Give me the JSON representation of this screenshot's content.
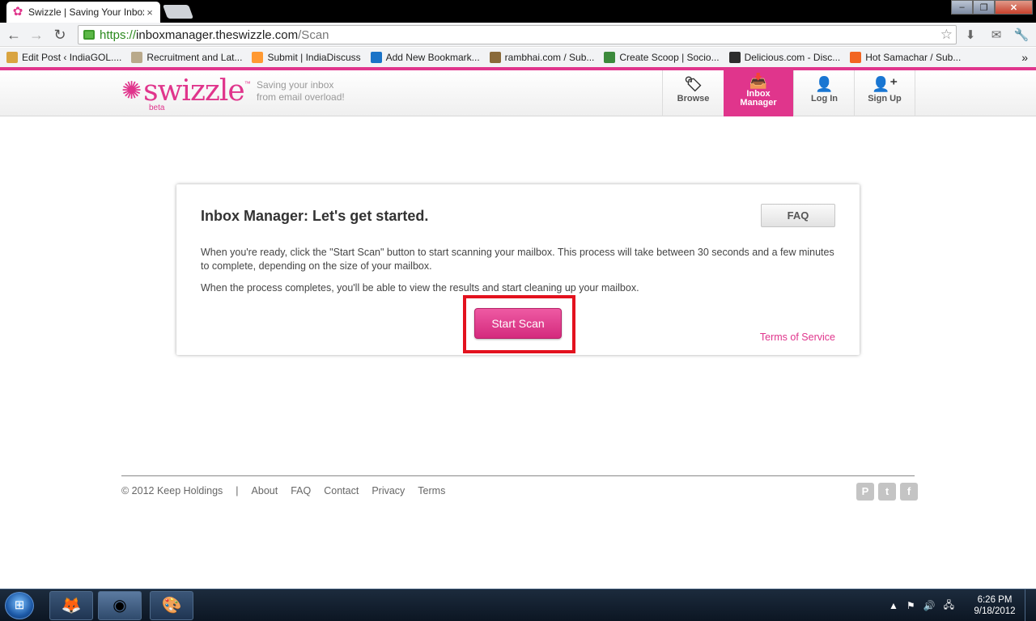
{
  "browser": {
    "tab_title": "Swizzle | Saving Your Inbox",
    "tab_close": "×",
    "url_scheme": "https://",
    "url_host": "inboxmanager.theswizzle.com",
    "url_path": "/Scan",
    "bookmarks": [
      {
        "label": "Edit Post ‹ IndiaGOL....",
        "color": "#d9a441"
      },
      {
        "label": "Recruitment and Lat...",
        "color": "#b9a98b"
      },
      {
        "label": "Submit | IndiaDiscuss",
        "color": "#ff9933"
      },
      {
        "label": "Add New Bookmark...",
        "color": "#1a73c7"
      },
      {
        "label": "rambhai.com / Sub...",
        "color": "#8a6a3a"
      },
      {
        "label": "Create Scoop | Socio...",
        "color": "#3c8a3c"
      },
      {
        "label": "Delicious.com - Disc...",
        "color": "#2d2d2d"
      },
      {
        "label": "Hot Samachar / Sub...",
        "color": "#f26522"
      }
    ],
    "bookmarks_overflow": "»"
  },
  "site": {
    "logo_text": "swizzle",
    "logo_tm": "™",
    "logo_beta": "beta",
    "tagline_line1": "Saving your inbox",
    "tagline_line2": "from email overload!",
    "nav": [
      {
        "label": "Browse",
        "icon": "tag-icon"
      },
      {
        "label_line1": "Inbox",
        "label_line2": "Manager",
        "icon": "inbox-icon",
        "active": true
      },
      {
        "label": "Log In",
        "icon": "user-icon"
      },
      {
        "label": "Sign Up",
        "icon": "add-user-icon"
      }
    ],
    "accent_color": "#e0358c"
  },
  "card": {
    "title": "Inbox Manager: Let's get started.",
    "faq_label": "FAQ",
    "paragraph1": "When you're ready, click the \"Start Scan\" button to start scanning your mailbox. This process will take between 30 seconds and a few minutes to complete, depending on the size of your mailbox.",
    "paragraph2": "When the process completes, you'll be able to view the results and start cleaning up your mailbox.",
    "start_scan_label": "Start Scan",
    "terms_label": "Terms of Service"
  },
  "footer": {
    "copyright": "© 2012 Keep Holdings",
    "separator": "|",
    "links": [
      "About",
      "FAQ",
      "Contact",
      "Privacy",
      "Terms"
    ],
    "social": [
      "pinterest-icon",
      "twitter-icon",
      "facebook-icon"
    ]
  },
  "taskbar": {
    "time": "6:26 PM",
    "date": "9/18/2012"
  }
}
